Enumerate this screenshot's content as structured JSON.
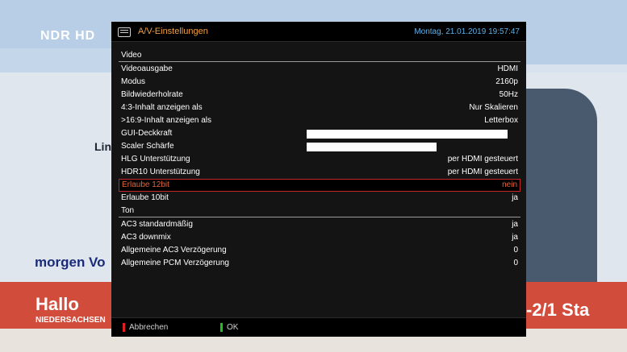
{
  "background": {
    "channel_logo": "NDR HD",
    "map_label": "Lin",
    "weather_text": "morgen Vo",
    "banner_title": "Hallo",
    "banner_subtitle": "NIEDERSACHSEN",
    "ticker_right": "-2/1  Sta"
  },
  "dialog": {
    "icon": "settings-panel-icon",
    "title": "A/V-Einstellungen",
    "datetime": "Montag, 21.01.2019  19:57:47",
    "sections": [
      {
        "title": "Video",
        "rows": [
          {
            "label": "Videoausgabe",
            "value": "HDMI"
          },
          {
            "label": "Modus",
            "value": "2160p"
          },
          {
            "label": "Bildwiederholrate",
            "value": "50Hz"
          },
          {
            "label": "4:3-Inhalt anzeigen als",
            "value": "Nur Skalieren"
          },
          {
            "label": ">16:9-Inhalt anzeigen als",
            "value": "Letterbox"
          },
          {
            "label": "GUI-Deckkraft",
            "bar": 0.99
          },
          {
            "label": "Scaler Schärfe",
            "bar": 0.64
          },
          {
            "label": "HLG Unterstützung",
            "value": "per HDMI gesteuert"
          },
          {
            "label": "HDR10 Unterstützung",
            "value": "per HDMI gesteuert"
          },
          {
            "label": "Erlaube 12bit",
            "value": "nein",
            "selected": true
          },
          {
            "label": "Erlaube 10bit",
            "value": "ja"
          }
        ]
      },
      {
        "title": "Ton",
        "rows": [
          {
            "label": "AC3 standardmäßig",
            "value": "ja"
          },
          {
            "label": "AC3 downmix",
            "value": "ja"
          },
          {
            "label": "Allgemeine AC3 Verzögerung",
            "value": "0"
          },
          {
            "label": "Allgemeine PCM Verzögerung",
            "value": "0"
          }
        ]
      }
    ],
    "footer": {
      "cancel_label": "Abbrechen",
      "ok_label": "OK"
    }
  },
  "colors": {
    "title": "#f0a040",
    "datetime": "#5fb0e8",
    "selected": "#e0643c",
    "red_key": "#e02020",
    "green_key": "#20c020"
  }
}
